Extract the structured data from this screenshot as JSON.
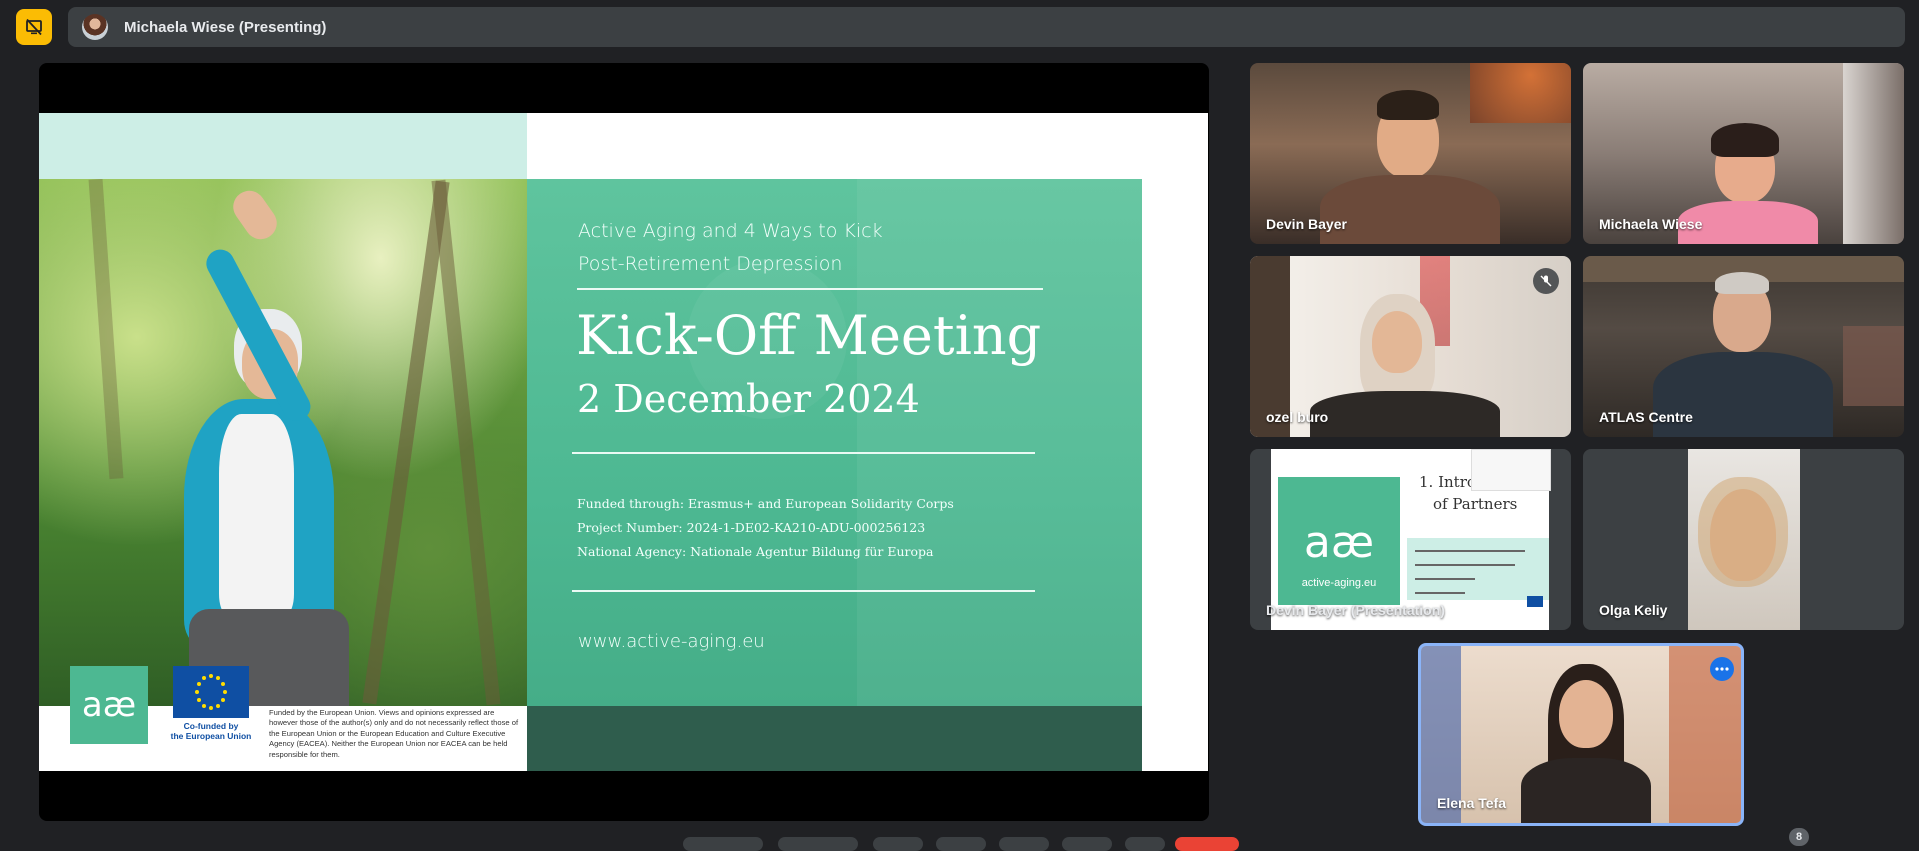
{
  "top_bar": {
    "presenter_label": "Michaela Wiese (Presenting)"
  },
  "slide": {
    "subtitle_line1": "Active Aging and 4 Ways to Kick",
    "subtitle_line2": "Post-Retirement Depression",
    "title": "Kick-Off Meeting",
    "date": "2 December 2024",
    "funding_line1": "Funded through: Erasmus+ and European Solidarity Corps",
    "funding_line2": "Project Number: 2024-1-DE02-KA210-ADU-000256123",
    "funding_line3": "National Agency: Nationale Agentur Bildung für Europa",
    "website": "www.active-aging.eu",
    "logo_text": "aæ",
    "eu_label_line1": "Co-funded by",
    "eu_label_line2": "the European Union",
    "disclaimer": "Funded by the European Union. Views and opinions expressed are however those of the author(s) only and do not necessarily reflect those of the European Union or the European Education and Culture Executive Agency (EACEA). Neither the European Union nor EACEA can be held responsible for them."
  },
  "participants": [
    {
      "name": "Devin Bayer"
    },
    {
      "name": "Michaela Wiese"
    },
    {
      "name": "ozel buro"
    },
    {
      "name": "ATLAS Centre"
    },
    {
      "name": "Devin Bayer (Presentation)"
    },
    {
      "name": "Olga Keliy"
    },
    {
      "name": "Elena Tefa"
    }
  ],
  "mini_slide": {
    "heading_line1": "1. Intro",
    "heading_line2": "of Partners",
    "site": "active-aging.eu"
  },
  "participant_count": "8",
  "colors": {
    "accent": "#fbbc04",
    "slide_green": "#4db892",
    "active_speaker": "#8ab4f8"
  }
}
